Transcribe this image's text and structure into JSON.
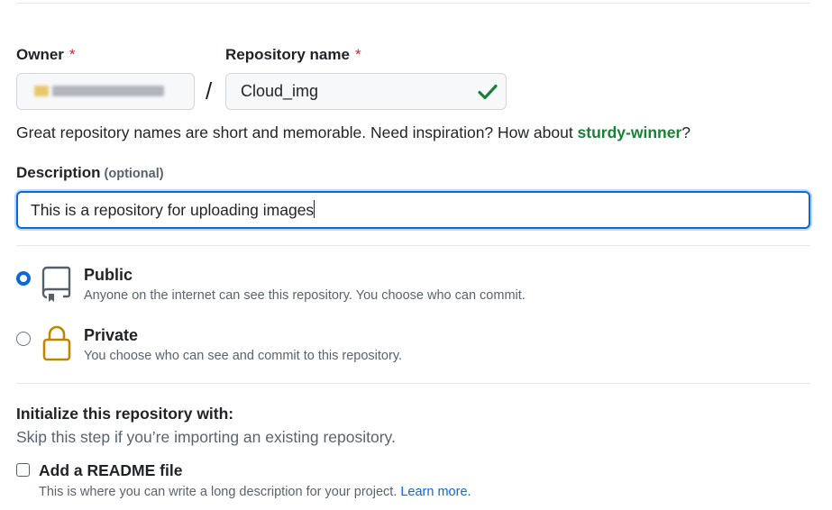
{
  "owner": {
    "label": "Owner",
    "required_mark": "*",
    "value_obscured": true
  },
  "separator": "/",
  "repository": {
    "label": "Repository name",
    "required_mark": "*",
    "value": "Cloud_img",
    "valid_icon": "check-icon"
  },
  "name_hint": {
    "prefix": "Great repository names are short and memorable. Need inspiration? How about ",
    "suggestion": "sturdy-winner",
    "suffix": "?"
  },
  "description": {
    "label": "Description",
    "optional_label": "(optional)",
    "value": "This is a repository for uploading images"
  },
  "visibility": {
    "options": [
      {
        "title": "Public",
        "description": "Anyone on the internet can see this repository. You choose who can commit.",
        "selected": true,
        "icon": "repo-icon"
      },
      {
        "title": "Private",
        "description": "You choose who can see and commit to this repository.",
        "selected": false,
        "icon": "lock-icon"
      }
    ]
  },
  "initialize": {
    "title": "Initialize this repository with:",
    "subtitle": "Skip this step if you’re importing an existing repository.",
    "readme": {
      "label": "Add a README file",
      "description": "This is where you can write a long description for your project. ",
      "link": "Learn more.",
      "checked": false
    }
  },
  "colors": {
    "accent": "#0969da",
    "success": "#1a7f37",
    "danger": "#cf222e",
    "lock": "#bf8700"
  }
}
